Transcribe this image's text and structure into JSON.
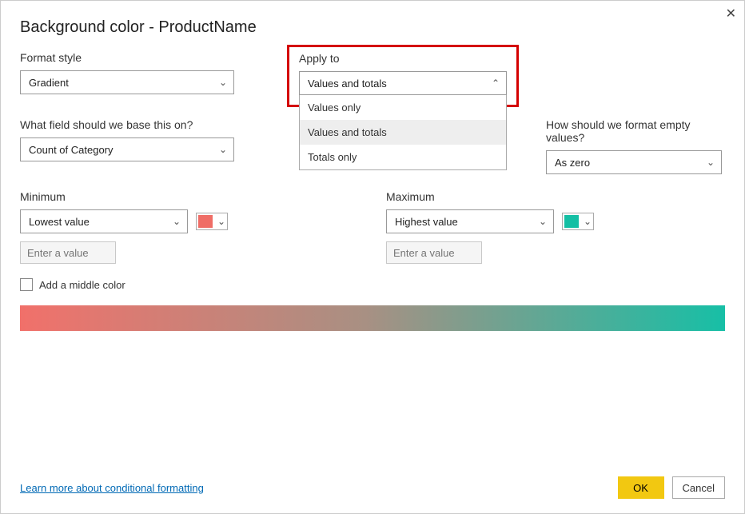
{
  "dialog": {
    "title": "Background color - ProductName"
  },
  "formatStyle": {
    "label": "Format style",
    "value": "Gradient"
  },
  "applyTo": {
    "label": "Apply to",
    "value": "Values and totals",
    "options": [
      "Values only",
      "Values and totals",
      "Totals only"
    ]
  },
  "basisField": {
    "label": "What field should we base this on?",
    "value": "Count of Category"
  },
  "emptyValues": {
    "label": "How should we format empty values?",
    "value": "As zero"
  },
  "minimum": {
    "label": "Minimum",
    "value": "Lowest value",
    "placeholder": "Enter a value",
    "color": "#ef6d66"
  },
  "maximum": {
    "label": "Maximum",
    "value": "Highest value",
    "placeholder": "Enter a value",
    "color": "#14bfa4"
  },
  "middleColor": {
    "label": "Add a middle color"
  },
  "footer": {
    "link": "Learn more about conditional formatting",
    "ok": "OK",
    "cancel": "Cancel"
  }
}
